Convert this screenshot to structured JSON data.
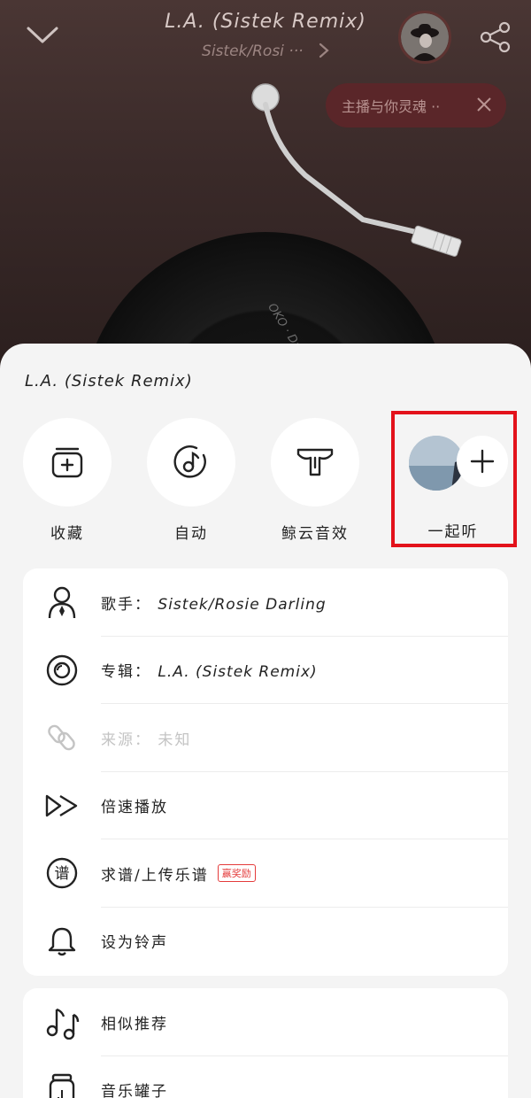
{
  "player": {
    "song_title": "L.A. (Sistek Remix)",
    "artist_short": "Sistek/Rosi ···",
    "anchor_bubble": "主播与你灵魂 ··",
    "vinyl_label": "OKO · Darling"
  },
  "sheet": {
    "title": "L.A. (Sistek Remix)",
    "actions": [
      {
        "label": "收藏",
        "icon": "collect-icon"
      },
      {
        "label": "自动",
        "icon": "auto-music-icon"
      },
      {
        "label": "鲸云音效",
        "icon": "whale-cloud-icon"
      },
      {
        "label": "一起听",
        "icon": "listen-together-icon"
      }
    ],
    "info_rows": [
      {
        "label": "歌手：",
        "value": "Sistek/Rosie Darling",
        "icon": "singer-icon"
      },
      {
        "label": "专辑：",
        "value": "L.A. (Sistek Remix)",
        "icon": "album-icon"
      },
      {
        "label": "来源：",
        "value": "未知",
        "icon": "link-icon"
      },
      {
        "label": "倍速播放",
        "icon": "speed-icon"
      },
      {
        "label": "求谱/上传乐谱",
        "badge": "赢奖励",
        "icon": "score-icon"
      },
      {
        "label": "设为铃声",
        "icon": "bell-icon"
      }
    ],
    "more_rows": [
      {
        "label": "相似推荐",
        "icon": "notes-icon"
      },
      {
        "label": "音乐罐子",
        "icon": "jar-icon"
      }
    ]
  },
  "colors": {
    "highlight": "#e3121b",
    "badge": "#e43b3b",
    "bubble": "#5a2629"
  }
}
